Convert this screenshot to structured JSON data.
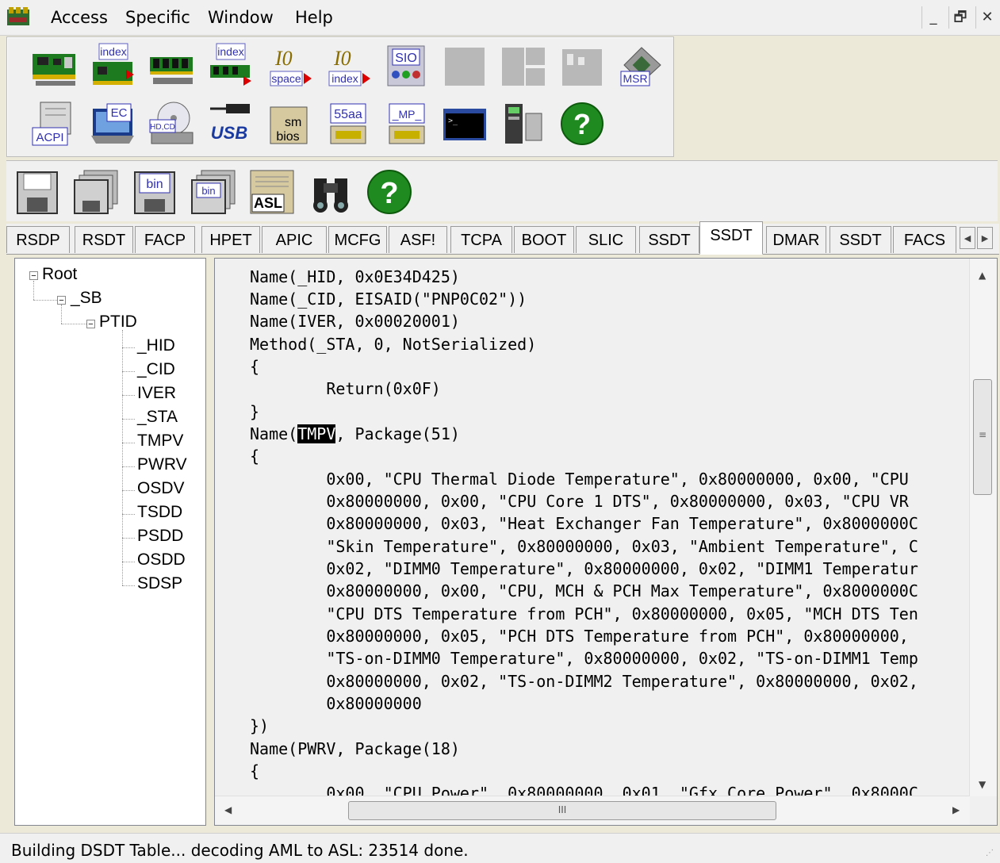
{
  "menu": {
    "items": [
      "Access",
      "Specific",
      "Window",
      "Help"
    ],
    "window_controls": [
      "_",
      "🗗",
      "✕"
    ]
  },
  "toolbar1": {
    "row1": [
      {
        "icon": "pci-card-icon",
        "label": ""
      },
      {
        "icon": "pci-index-icon",
        "label": "index"
      },
      {
        "icon": "memory-module-icon",
        "label": ""
      },
      {
        "icon": "memory-index-icon",
        "label": "index"
      },
      {
        "icon": "io-space-icon",
        "label": "space"
      },
      {
        "icon": "io-index-icon",
        "label": "index"
      },
      {
        "icon": "sio-chip-icon",
        "label": "SIO"
      },
      {
        "icon": "disabled-icon-1",
        "label": ""
      },
      {
        "icon": "disabled-icon-2",
        "label": ""
      },
      {
        "icon": "disabled-icon-3",
        "label": ""
      },
      {
        "icon": "msr-cpu-icon",
        "label": "MSR"
      }
    ],
    "row2": [
      {
        "icon": "acpi-icon",
        "label": "ACPI"
      },
      {
        "icon": "ec-icon",
        "label": "EC"
      },
      {
        "icon": "hdd-cd-icon",
        "label": "HD,CD"
      },
      {
        "icon": "usb-icon",
        "label": "USB"
      },
      {
        "icon": "smbios-icon",
        "label": "sm bios"
      },
      {
        "icon": "rom-55aa-icon",
        "label": "55aa"
      },
      {
        "icon": "mp-table-icon",
        "label": "_MP_"
      },
      {
        "icon": "command-prompt-icon",
        "label": ""
      },
      {
        "icon": "device-icon",
        "label": ""
      },
      {
        "icon": "help-icon",
        "label": "?"
      }
    ]
  },
  "toolbar2": [
    {
      "icon": "save-icon",
      "label": ""
    },
    {
      "icon": "save-all-icon",
      "label": ""
    },
    {
      "icon": "save-bin-icon",
      "label": "bin"
    },
    {
      "icon": "save-all-bin-icon",
      "label": "bin"
    },
    {
      "icon": "asl-icon",
      "label": "ASL"
    },
    {
      "icon": "find-icon",
      "label": ""
    },
    {
      "icon": "help-icon",
      "label": "?"
    }
  ],
  "tabs": [
    "RSDP",
    "RSDT",
    "FACP",
    "HPET",
    "APIC",
    "MCFG",
    "ASF!",
    "TCPA",
    "BOOT",
    "SLIC",
    "SSDT",
    "SSDT",
    "DMAR",
    "SSDT",
    "FACS"
  ],
  "active_tab_index": 11,
  "tree": {
    "root": "Root",
    "sb": "_SB",
    "ptid": "PTID",
    "leaves": [
      "_HID",
      "_CID",
      "IVER",
      "_STA",
      "TMPV",
      "PWRV",
      "OSDV",
      "TSDD",
      "PSDD",
      "OSDD",
      "SDSP"
    ]
  },
  "code": {
    "lines": [
      "Name(_HID, 0x0E34D425)",
      "Name(_CID, EISAID(\"PNP0C02\"))",
      "Name(IVER, 0x00020001)",
      "Method(_STA, 0, NotSerialized)",
      "{",
      "        Return(0x0F)",
      "}",
      "Name(",
      "{",
      "        0x00, \"CPU Thermal Diode Temperature\", 0x80000000, 0x00, \"CPU",
      "        0x80000000, 0x00, \"CPU Core 1 DTS\", 0x80000000, 0x03, \"CPU VR",
      "        0x80000000, 0x03, \"Heat Exchanger Fan Temperature\", 0x8000000C",
      "        \"Skin Temperature\", 0x80000000, 0x03, \"Ambient Temperature\", C",
      "        0x02, \"DIMM0 Temperature\", 0x80000000, 0x02, \"DIMM1 Temperatur",
      "        0x80000000, 0x00, \"CPU, MCH & PCH Max Temperature\", 0x8000000C",
      "        \"CPU DTS Temperature from PCH\", 0x80000000, 0x05, \"MCH DTS Ten",
      "        0x80000000, 0x05, \"PCH DTS Temperature from PCH\", 0x80000000,",
      "        \"TS-on-DIMM0 Temperature\", 0x80000000, 0x02, \"TS-on-DIMM1 Temp",
      "        0x80000000, 0x02, \"TS-on-DIMM2 Temperature\", 0x80000000, 0x02,",
      "        0x80000000",
      "})",
      "Name(PWRV, Package(18)",
      "{",
      "        0x00, \"CPU Power\", 0x80000000, 0x01, \"Gfx Core Power\", 0x8000C"
    ],
    "highlight_token": "TMPV",
    "highlight_rest": ", Package(51)"
  },
  "hscroll_grip": "III",
  "status": {
    "text": "Building DSDT Table... decoding AML to ASL: 23514 done."
  }
}
